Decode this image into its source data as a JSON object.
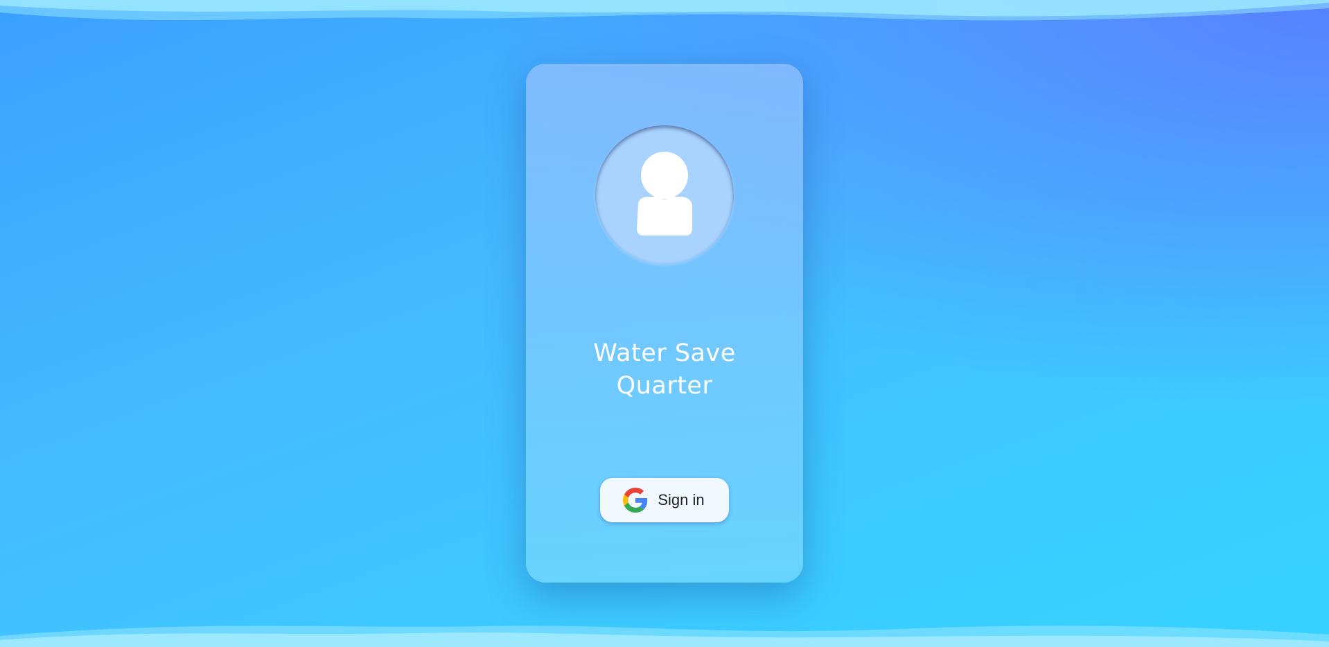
{
  "app": {
    "title": "Water Save\nQuarter"
  },
  "avatar": {
    "icon": "user-icon"
  },
  "signin": {
    "label": "Sign in",
    "icon": "google-icon"
  },
  "colors": {
    "background_top": "#3aa0ff",
    "background_bottom": "#37d2ff",
    "accent_corner": "#5f6eff",
    "card": "#82c8ff",
    "button": "#f2f8ff",
    "text_light": "#ffffff",
    "text_dark": "#222222"
  }
}
